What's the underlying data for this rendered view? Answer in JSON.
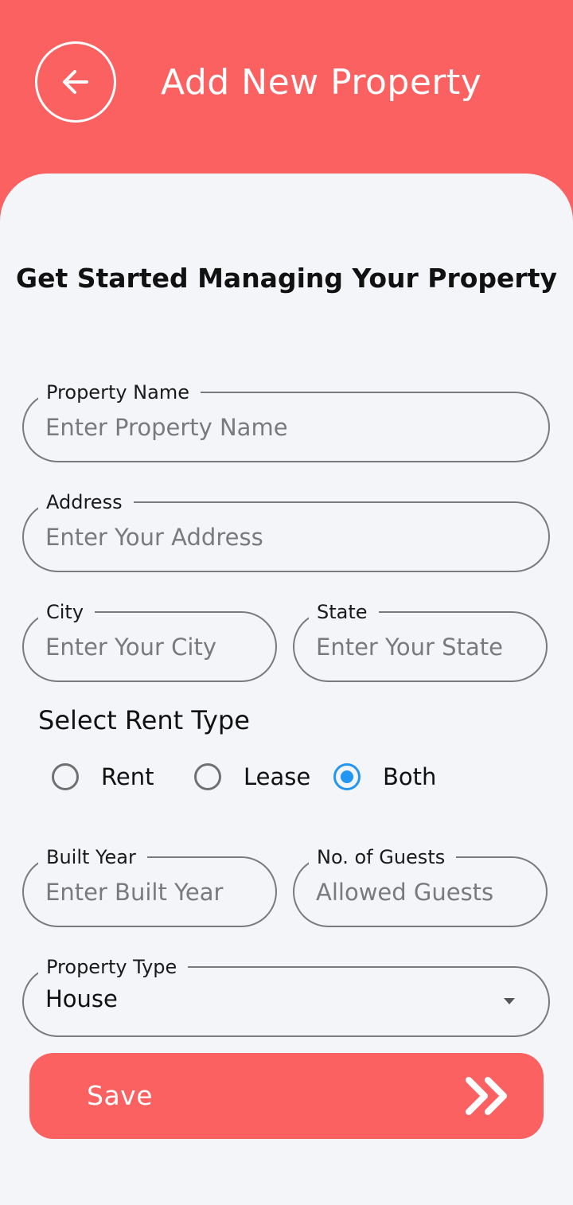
{
  "header": {
    "title": "Add New Property",
    "back_icon": "arrow-left-icon",
    "background": "#fc6162"
  },
  "headline": "Get Started Managing Your Property",
  "fields": {
    "property_name": {
      "label": "Property Name",
      "placeholder": "Enter Property Name",
      "value": ""
    },
    "address": {
      "label": "Address",
      "placeholder": "Enter Your Address",
      "value": ""
    },
    "city": {
      "label": "City",
      "placeholder": "Enter Your City",
      "value": ""
    },
    "state": {
      "label": "State",
      "placeholder": "Enter Your State",
      "value": ""
    },
    "built_year": {
      "label": "Built Year",
      "placeholder": "Enter Built Year",
      "value": ""
    },
    "guests": {
      "label": "No. of Guests",
      "placeholder": "Allowed Guests",
      "value": ""
    }
  },
  "rent_type": {
    "label": "Select Rent Type",
    "options": [
      "Rent",
      "Lease",
      "Both"
    ],
    "selected": "Both",
    "accent": "#2196f3"
  },
  "property_type": {
    "label": "Property Type",
    "value": "House",
    "icon": "caret-down-icon"
  },
  "save": {
    "label": "Save",
    "icon": "double-chevron-right-icon",
    "background": "#fc6162"
  }
}
